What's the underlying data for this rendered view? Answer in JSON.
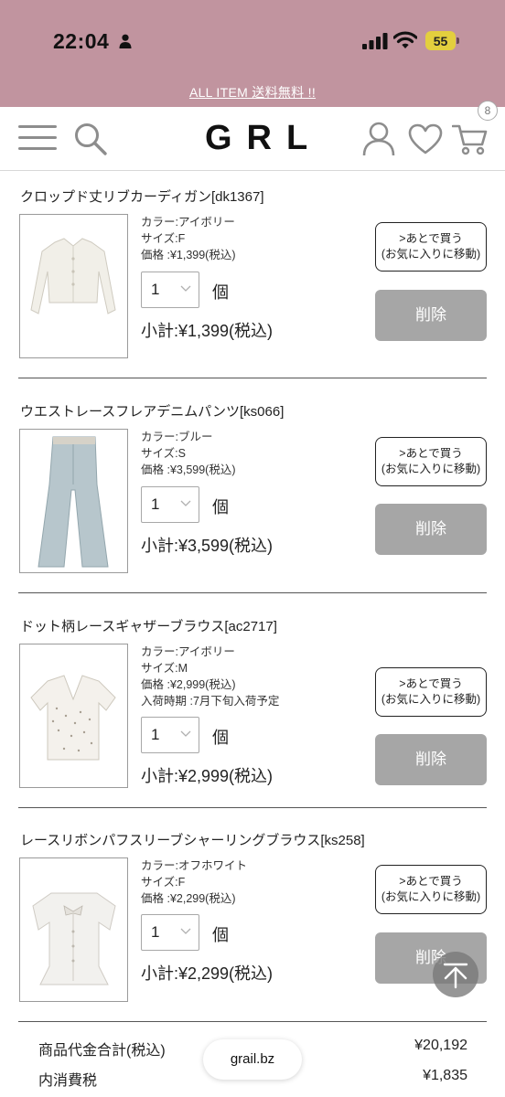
{
  "status_bar": {
    "time": "22:04",
    "battery": "55"
  },
  "promo": {
    "text": "ALL ITEM 送料無料 !!"
  },
  "header": {
    "logo": "GRL",
    "cart_count": "8",
    "icons": [
      "menu-icon",
      "search-icon",
      "account-icon",
      "heart-icon",
      "cart-icon"
    ]
  },
  "cart": {
    "items": [
      {
        "title": "クロップド丈リブカーディガン[dk1367]",
        "color": "カラー:アイボリー",
        "size": "サイズ:F",
        "price": "価格 :¥1,399(税込)",
        "quantity": "1",
        "unit": "個",
        "subtotal": "小計:¥1,399(税込)",
        "later_line1": ">あとで買う",
        "later_line2": "(お気に入りに移動)",
        "delete": "削除"
      },
      {
        "title": "ウエストレースフレアデニムパンツ[ks066]",
        "color": "カラー:ブルー",
        "size": "サイズ:S",
        "price": "価格 :¥3,599(税込)",
        "quantity": "1",
        "unit": "個",
        "subtotal": "小計:¥3,599(税込)",
        "later_line1": ">あとで買う",
        "later_line2": "(お気に入りに移動)",
        "delete": "削除"
      },
      {
        "title": "ドット柄レースギャザーブラウス[ac2717]",
        "color": "カラー:アイボリー",
        "size": "サイズ:M",
        "price": "価格 :¥2,999(税込)",
        "arrival": "入荷時期 :7月下旬入荷予定",
        "quantity": "1",
        "unit": "個",
        "subtotal": "小計:¥2,999(税込)",
        "later_line1": ">あとで買う",
        "later_line2": "(お気に入りに移動)",
        "delete": "削除"
      },
      {
        "title": "レースリボンパフスリーブシャーリングブラウス[ks258]",
        "color": "カラー:オフホワイト",
        "size": "サイズ:F",
        "price": "価格 :¥2,299(税込)",
        "quantity": "1",
        "unit": "個",
        "subtotal": "小計:¥2,299(税込)",
        "later_line1": ">あとで買う",
        "later_line2": "(お気に入りに移動)",
        "delete": "削除"
      }
    ]
  },
  "totals": {
    "goods_label": "商品代金合計(税込)",
    "goods_value": "¥20,192",
    "tax_label": "内消費税",
    "tax_value": "¥1,835"
  },
  "browser": {
    "url": "grail.bz"
  },
  "colors": {
    "brand_pink": "#c1949f",
    "delete_gray": "#a6a6a6",
    "battery_yellow": "#e3cf3e"
  }
}
